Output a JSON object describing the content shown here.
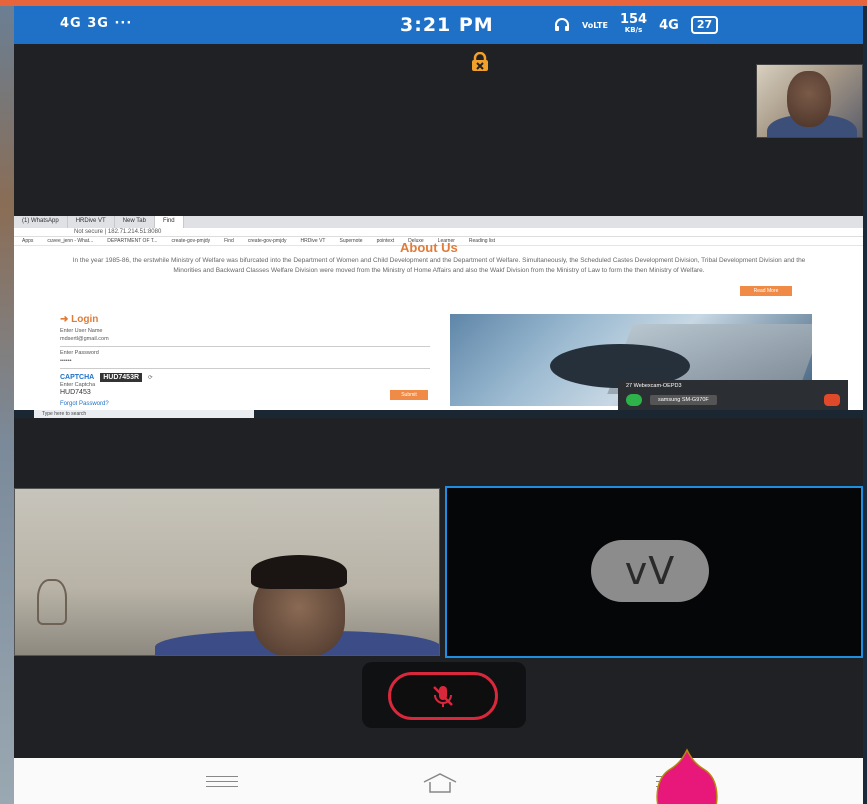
{
  "status_bar": {
    "left_indicators": "4G  3G  ···",
    "time": "3:21 PM",
    "network_label": "VoLTE",
    "speed_value": "154",
    "speed_unit": "KB/s",
    "right_network": "4G",
    "battery": "27"
  },
  "screen_share": {
    "tabs": [
      "(1) WhatsApp",
      "HRDive VT",
      "New Tab",
      "Find"
    ],
    "address": "Not secure | 182.71.214.51:8080",
    "bookmarks": [
      "Apps",
      "cuvee_jenn - What...",
      "DEPARTMENT OF T...",
      "create-gov-pmjdy",
      "Find",
      "create-gov-pmjdy",
      "HRDive VT",
      "Supernote",
      "pointext",
      "Deluxe",
      "Learner",
      "Reading list"
    ],
    "about_title": "About Us",
    "about_text": "In the year 1985-86, the erstwhile Ministry of Welfare was bifurcated into the Department of Women and Child Development and the Department of Welfare. Simultaneously, the Scheduled Castes Development Division, Tribal Development Division and the Minorities and Backward Classes Welfare Division were moved from the Ministry of Home Affairs and also the Wakf Division from the Ministry of Law to form the then Ministry of Welfare.",
    "read_more": "Read More",
    "login": {
      "title": "Login",
      "user_label": "Enter User Name",
      "user_value": "mdsertl@gmail.com",
      "password_label": "Enter Password",
      "password_value": "••••••",
      "captcha_label": "CAPTCHA",
      "captcha_image_text": "HUD7453R",
      "captcha_input_label": "Enter Captcha",
      "captcha_input_value": "HUD7453",
      "forgot": "Forgot Password?",
      "submit": "Submit"
    },
    "webex_popup": {
      "title": "27  Webexcam-OEPD3",
      "device": "samsung SM-G970F"
    },
    "taskbar_search": "Type here to search"
  },
  "participants": {
    "avatar_initials": "vV"
  },
  "colors": {
    "status_bar": "#1e71c7",
    "accent_orange": "#e07b39",
    "mute_red": "#d9283c",
    "active_border": "#1e8ee0",
    "marker_pink": "#e8177a"
  }
}
